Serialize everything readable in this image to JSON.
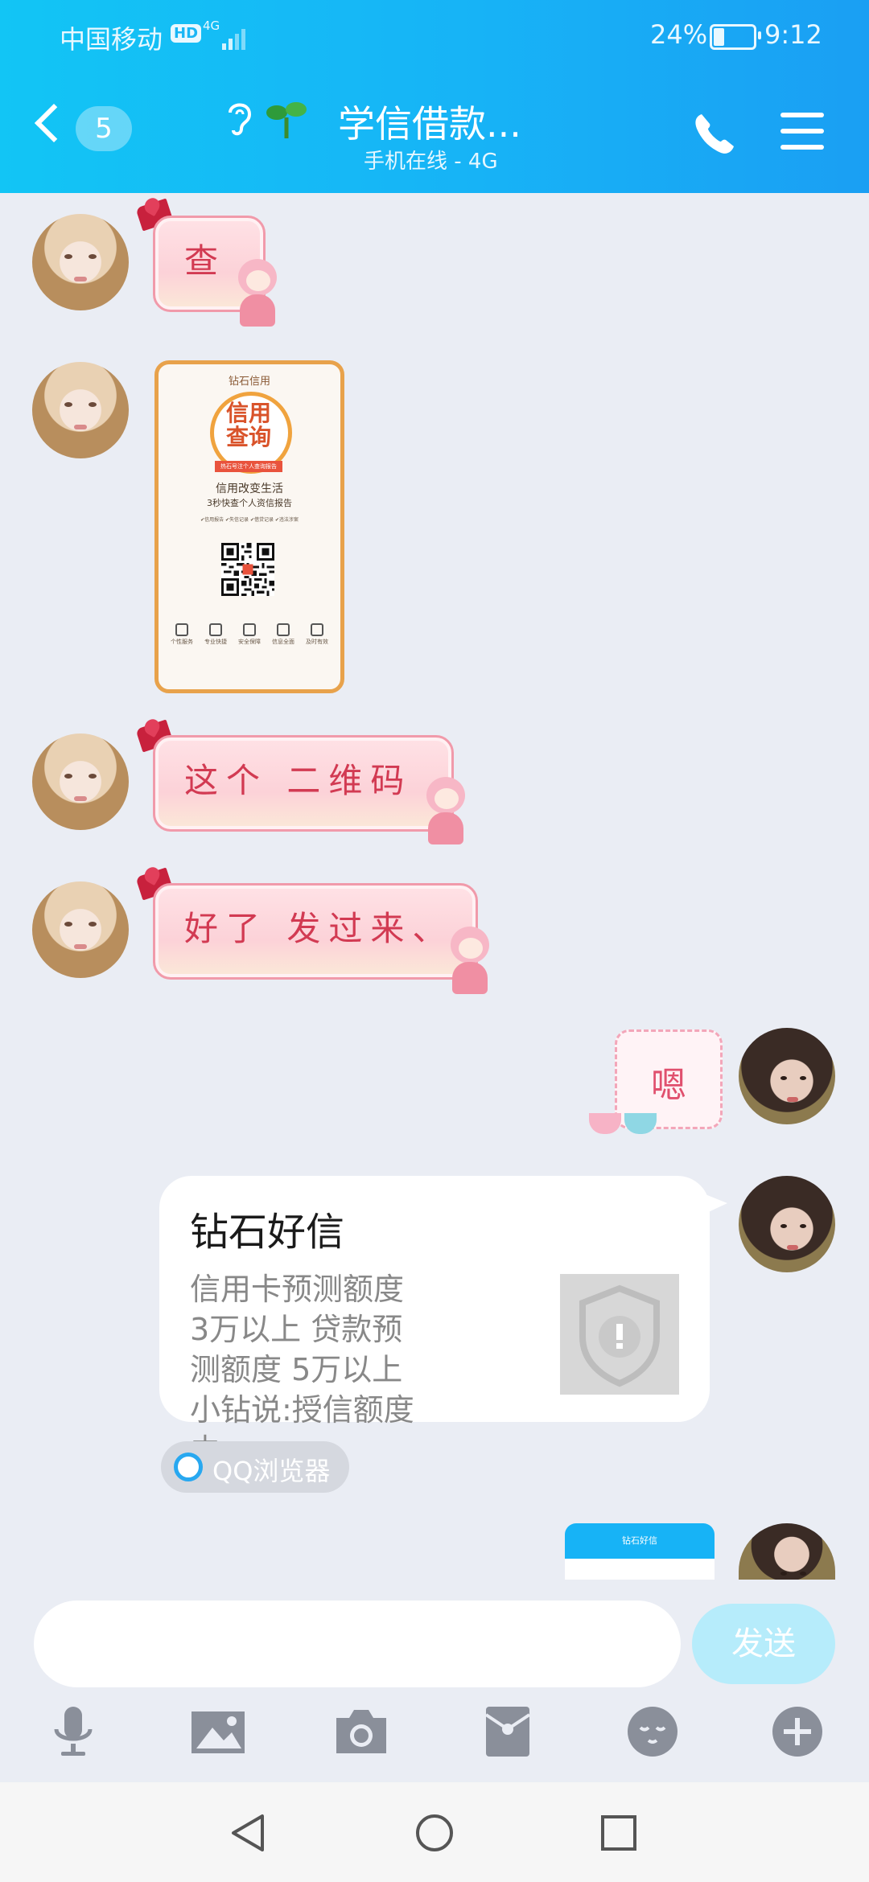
{
  "status_bar": {
    "carrier": "中国移动",
    "hd": "HD",
    "network": "4G",
    "battery": "24%",
    "time": "9:12"
  },
  "header": {
    "back_count": "5",
    "title": "学信借款...",
    "subtitle": "手机在线 - 4G"
  },
  "messages": [
    {
      "text": "查"
    },
    {
      "image": {
        "brand": "钻石信用",
        "big_text": "信用查询",
        "ribbon": "热石号注个人查询报告",
        "line1": "信用改变生活",
        "line2": "3秒快查个人资信报告",
        "tags": "✔信用报告 ✔失信记录 ✔借贷记录 ✔违法涉案",
        "icons": [
          "个性服务",
          "专业快捷",
          "安全保障",
          "信息全面",
          "及时有效"
        ]
      }
    },
    {
      "text": "这个 二维码"
    },
    {
      "text": "好了 发过来、"
    },
    {
      "text": "嗯"
    }
  ],
  "share_card": {
    "title": "钻石好信",
    "desc": "信用卡预测额度 3万以上 贷款预测额度 5万以上 小钻说:授信额度由...",
    "source": "QQ浏览器",
    "mini_title": "钻石好信"
  },
  "input": {
    "placeholder": "",
    "send_label": "发送"
  },
  "icons": {
    "back": "chevron-left-icon",
    "ear": "ear-icon",
    "sprout": "sprout-icon",
    "phone": "phone-icon",
    "menu": "menu-icon",
    "mic": "mic-icon",
    "image": "image-icon",
    "camera": "camera-icon",
    "red_packet": "red-packet-icon",
    "emoji": "emoji-icon",
    "plus": "plus-icon"
  },
  "colors": {
    "header_start": "#12c5f5",
    "header_end": "#1a9ff3",
    "chat_bg": "#eaedf4",
    "send_button": "#b6ecfb"
  }
}
